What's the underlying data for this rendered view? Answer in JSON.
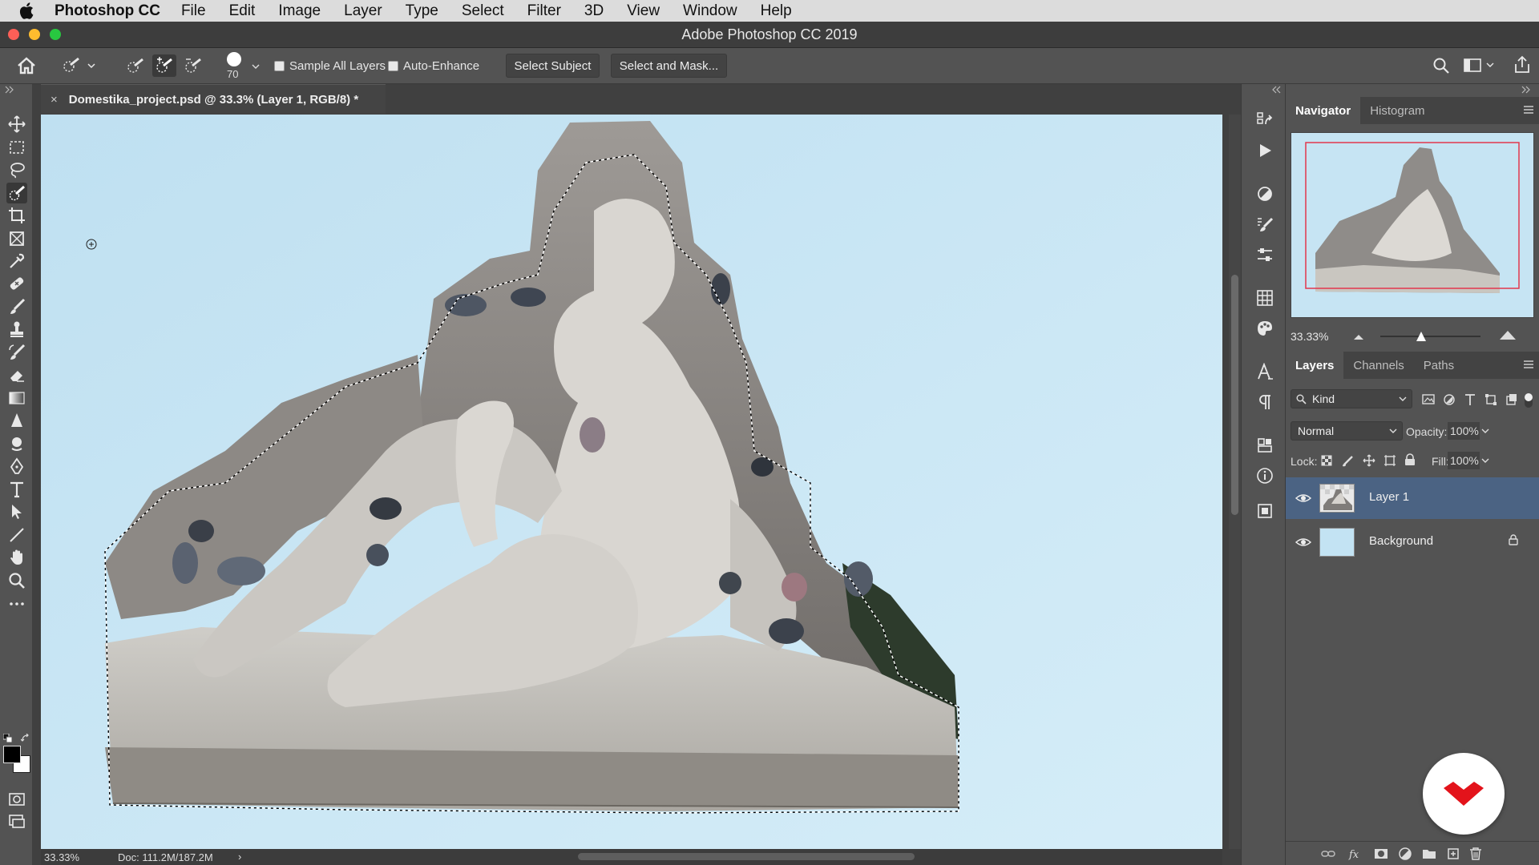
{
  "menubar": {
    "app_name": "Photoshop CC",
    "items": [
      "File",
      "Edit",
      "Image",
      "Layer",
      "Type",
      "Select",
      "Filter",
      "3D",
      "View",
      "Window",
      "Help"
    ]
  },
  "window": {
    "title": "Adobe Photoshop CC 2019"
  },
  "options_bar": {
    "brush_size": "70",
    "sample_all_layers": "Sample All Layers",
    "auto_enhance": "Auto-Enhance",
    "select_subject": "Select Subject",
    "select_and_mask": "Select and Mask..."
  },
  "document": {
    "tab_title": "Domestika_project.psd @ 33.3% (Layer 1, RGB/8) *",
    "close_glyph": "×",
    "zoom": "33.33%",
    "doc_size": "Doc: 111.2M/187.2M",
    "status_arrow": "›"
  },
  "navigator": {
    "tabs": [
      "Navigator",
      "Histogram"
    ],
    "zoom": "33.33%"
  },
  "layers_panel": {
    "tabs": [
      "Layers",
      "Channels",
      "Paths"
    ],
    "filter": "Kind",
    "blend_mode": "Normal",
    "opacity_label": "Opacity:",
    "opacity": "100%",
    "lock_label": "Lock:",
    "fill_label": "Fill:",
    "fill": "100%",
    "layers": [
      {
        "name": "Layer 1",
        "selected": true
      },
      {
        "name": "Background",
        "locked": true
      }
    ]
  },
  "colors": {
    "canvas_sky": "#c9e6f4",
    "selection_highlight": "#4b6383",
    "badge_red": "#e3131b"
  }
}
